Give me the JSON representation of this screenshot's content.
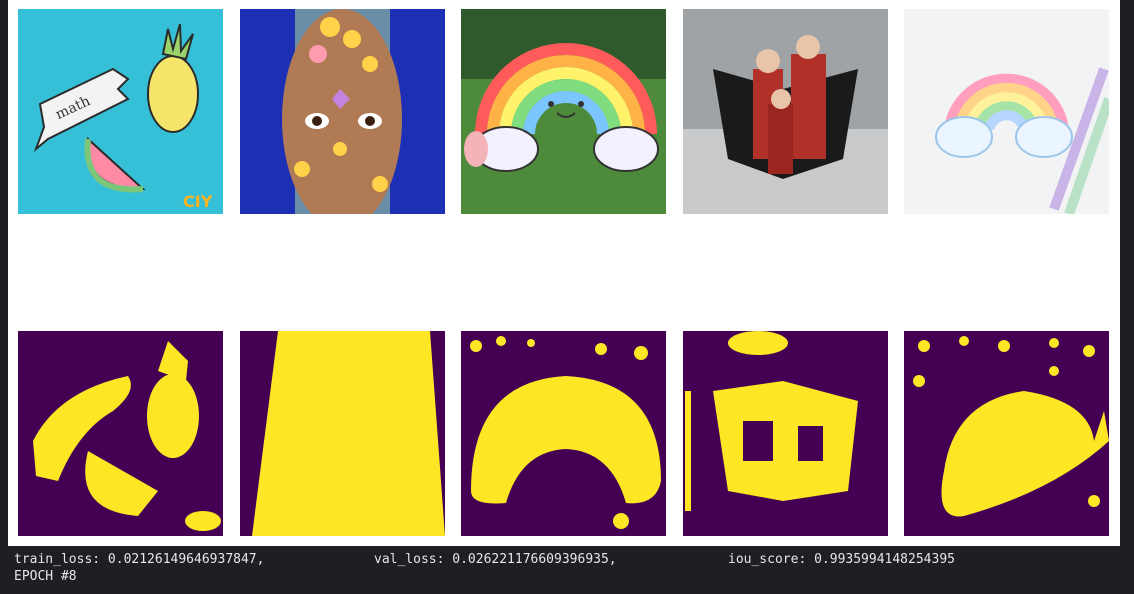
{
  "images": [
    {
      "name": "sticker-math-pineapple-watermelon"
    },
    {
      "name": "sticker-face-emoji"
    },
    {
      "name": "sticker-rainbow-grass"
    },
    {
      "name": "sticker-spiderman-laptop"
    },
    {
      "name": "sticker-pastel-rainbow"
    }
  ],
  "masks": [
    {
      "name": "mask-1"
    },
    {
      "name": "mask-2"
    },
    {
      "name": "mask-3"
    },
    {
      "name": "mask-4"
    },
    {
      "name": "mask-5"
    }
  ],
  "log": {
    "train_loss": "train_loss: 0.02126149646937847,",
    "val_loss": "val_loss: 0.026221176609396935,",
    "iou_score": "iou_score: 0.9935994148254395",
    "epoch": "EPOCH #8"
  },
  "colors": {
    "mask_bg": "#440154",
    "mask_fg": "#fde725",
    "console_bg": "#1e1f22"
  }
}
